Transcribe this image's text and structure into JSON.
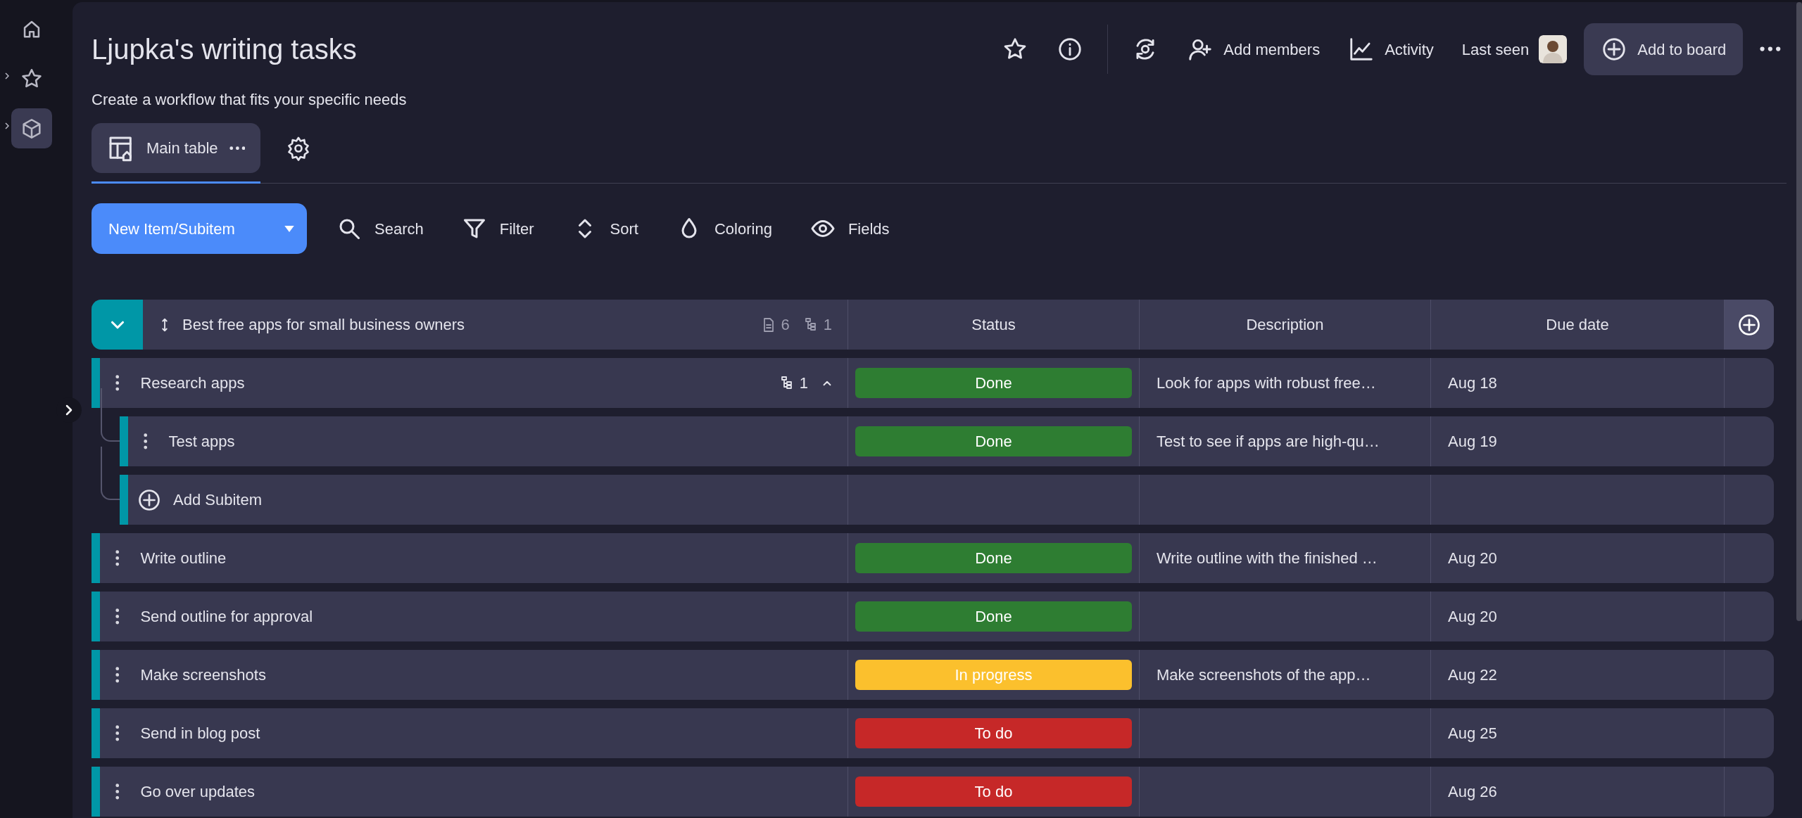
{
  "sidebar": {
    "items": [
      {
        "kind": "home",
        "selected": false,
        "expandable": false
      },
      {
        "kind": "star",
        "selected": false,
        "expandable": true
      },
      {
        "kind": "box",
        "selected": true,
        "expandable": true
      }
    ]
  },
  "board": {
    "title": "Ljupka's writing tasks",
    "subtitle": "Create a workflow that fits your specific needs"
  },
  "header_actions": [
    {
      "kind": "star"
    },
    {
      "kind": "info"
    },
    {
      "kind": "sync"
    },
    {
      "kind": "add-members",
      "label": "Add members"
    },
    {
      "kind": "activity",
      "label": "Activity"
    },
    {
      "kind": "last-seen",
      "label": "Last seen"
    },
    {
      "kind": "add-to-board",
      "label": "Add to board"
    },
    {
      "kind": "more"
    }
  ],
  "tabs": [
    {
      "label": "Main table",
      "selected": true
    }
  ],
  "toolbar": {
    "new_item": "New Item/Subitem",
    "tools": [
      {
        "kind": "search",
        "label": "Search"
      },
      {
        "kind": "filter",
        "label": "Filter"
      },
      {
        "kind": "sort",
        "label": "Sort"
      },
      {
        "kind": "coloring",
        "label": "Coloring"
      },
      {
        "kind": "fields",
        "label": "Fields"
      }
    ]
  },
  "group": {
    "title": "Best free apps for small business owners",
    "expanded": true,
    "item_count": "6",
    "subitem_count": "1",
    "columns": [
      "Status",
      "Description",
      "Due date"
    ],
    "rows": [
      {
        "name": "Research apps",
        "status": {
          "label": "Done",
          "color": "#2e7d32"
        },
        "description": "Look for apps with robust free…",
        "due": "Aug 18",
        "subitem_count": "1",
        "expanded": true,
        "children": [
          {
            "name": "Test apps",
            "status": {
              "label": "Done",
              "color": "#2e7d32"
            },
            "description": "Test to see if apps are high-qu…",
            "due": "Aug 19"
          }
        ],
        "add_subitem": "Add Subitem"
      },
      {
        "name": "Write outline",
        "status": {
          "label": "Done",
          "color": "#2e7d32"
        },
        "description": "Write outline with the finished …",
        "due": "Aug 20"
      },
      {
        "name": "Send outline for approval",
        "status": {
          "label": "Done",
          "color": "#2e7d32"
        },
        "due": "Aug 20"
      },
      {
        "name": "Make screenshots",
        "status": {
          "label": "In progress",
          "color": "#fbc02d"
        },
        "description": "Make screenshots of the app…",
        "due": "Aug 22"
      },
      {
        "name": "Send in blog post",
        "status": {
          "label": "To do",
          "color": "#c62828"
        },
        "due": "Aug 25"
      },
      {
        "name": "Go over updates",
        "status": {
          "label": "To do",
          "color": "#c62828"
        },
        "due": "Aug 26"
      }
    ]
  }
}
